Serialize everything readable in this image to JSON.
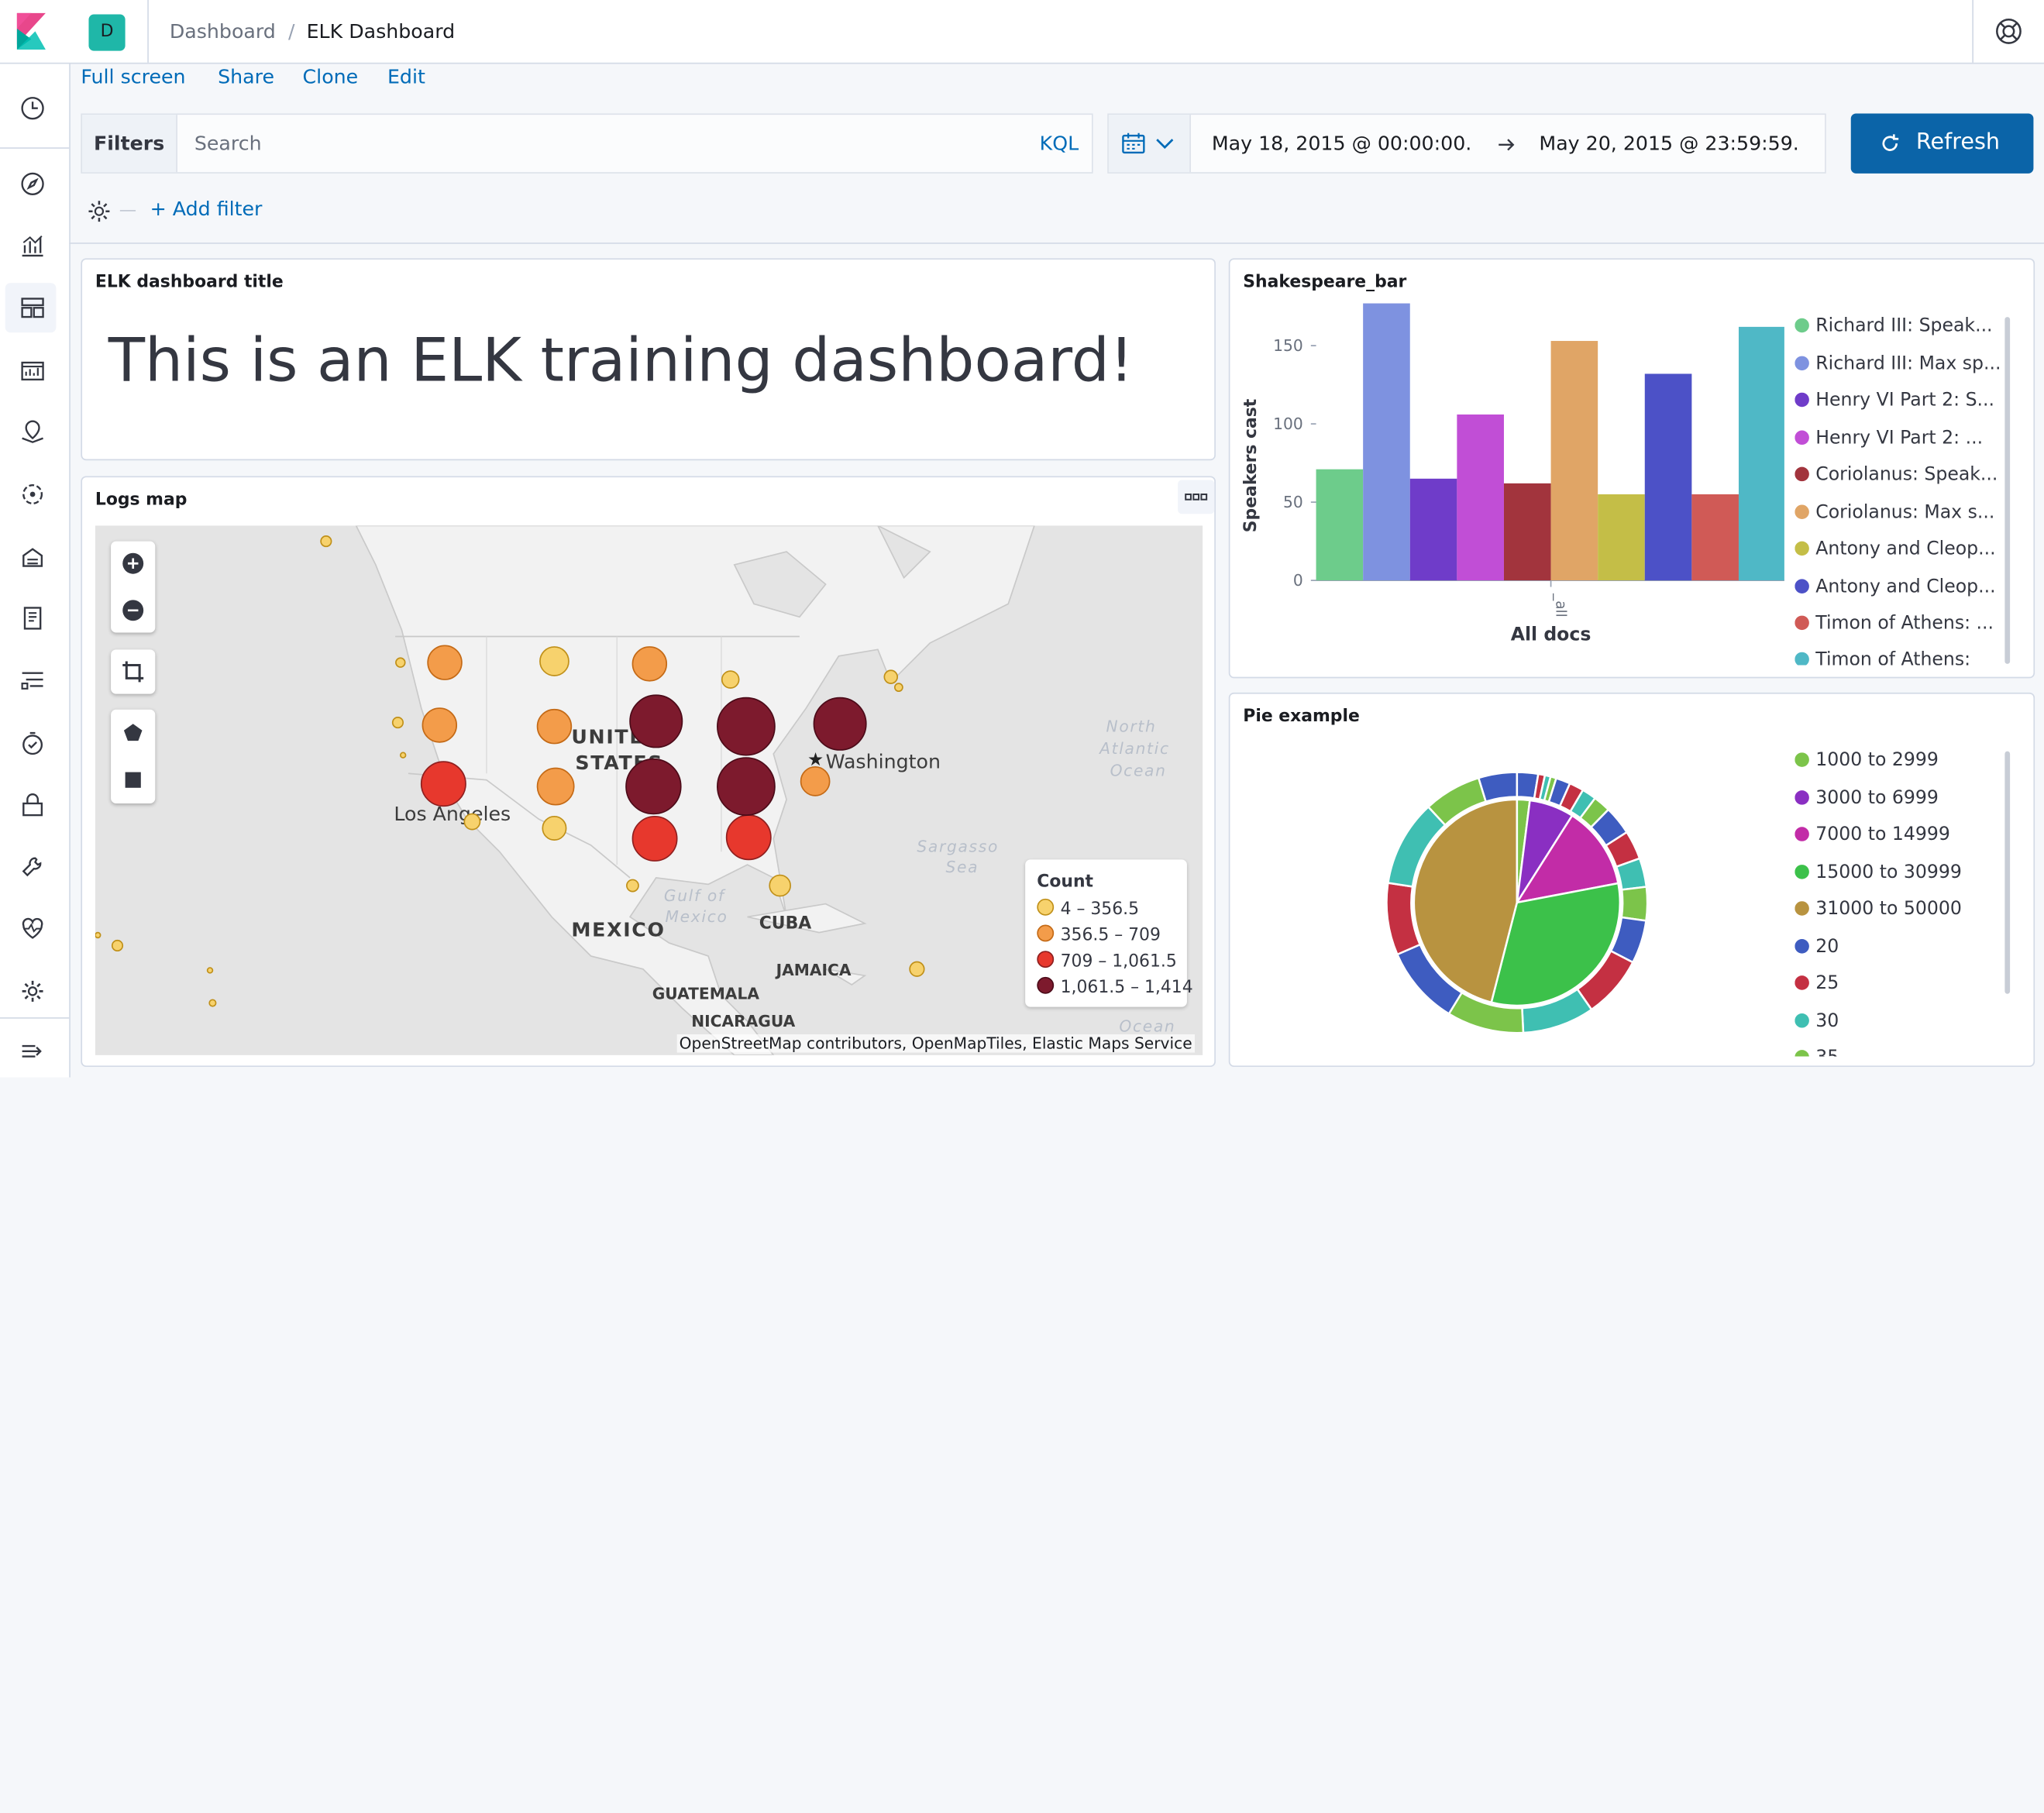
{
  "header": {
    "space_initial": "D",
    "breadcrumb_root": "Dashboard",
    "breadcrumb_current": "ELK Dashboard"
  },
  "top_links": [
    "Full screen",
    "Share",
    "Clone",
    "Edit"
  ],
  "query_bar": {
    "filters_label": "Filters",
    "search_placeholder": "Search",
    "language": "KQL",
    "date_start": "May 18, 2015 @ 00:00:00.",
    "date_end": "May 20, 2015 @ 23:59:59.",
    "refresh_label": "Refresh",
    "add_filter": "+ Add filter"
  },
  "panels": {
    "markdown": {
      "title": "ELK dashboard title",
      "text": "This is an ELK training dashboard!"
    },
    "map": {
      "title": "Logs map",
      "labels": [
        "UNITED",
        "STATES",
        "Washington",
        "Los Angeles",
        "MEXICO",
        "CUBA",
        "JAMAICA",
        "GUATEMALA",
        "NICARAGUA"
      ],
      "ocean_labels": [
        "North",
        "Atlantic",
        "Ocean",
        "Sargasso",
        "Sea",
        "Gulf of",
        "Mexico",
        "Ocean"
      ],
      "attribution": "OpenStreetMap contributors, OpenMapTiles, Elastic Maps Service",
      "legend_title": "Count",
      "legend": [
        {
          "label": "4 – 356.5",
          "color": "#f7d26d"
        },
        {
          "label": "356.5 – 709",
          "color": "#f39c4a"
        },
        {
          "label": "709 – 1,061.5",
          "color": "#e7382d"
        },
        {
          "label": "1,061.5 – 1,414",
          "color": "#7d1a2d"
        }
      ]
    },
    "bar": {
      "title": "Shakespeare_bar",
      "legend": [
        {
          "label": "Richard III: Speak...",
          "color": "#6dcc8b"
        },
        {
          "label": "Richard III: Max sp...",
          "color": "#7e92e0"
        },
        {
          "label": "Henry VI Part 2: S...",
          "color": "#6f3cc9"
        },
        {
          "label": "Henry VI Part 2: ...",
          "color": "#c14ed6"
        },
        {
          "label": "Coriolanus: Speak...",
          "color": "#a2343d"
        },
        {
          "label": "Coriolanus: Max s...",
          "color": "#e0a566"
        },
        {
          "label": "Antony and Cleop...",
          "color": "#c4be47"
        },
        {
          "label": "Antony and Cleop...",
          "color": "#4c51c7"
        },
        {
          "label": "Timon of Athens: ...",
          "color": "#d05a56"
        },
        {
          "label": "Timon of Athens:",
          "color": "#4fb8c6"
        }
      ]
    },
    "pie": {
      "title": "Pie example",
      "legend": [
        {
          "label": "1000 to 2999",
          "color": "#7cc44a"
        },
        {
          "label": "3000 to 6999",
          "color": "#8a2fc2"
        },
        {
          "label": "7000 to 14999",
          "color": "#c22ca7"
        },
        {
          "label": "15000 to 30999",
          "color": "#3cc14a"
        },
        {
          "label": "31000 to 50000",
          "color": "#b89340"
        },
        {
          "label": "20",
          "color": "#3e5cc0"
        },
        {
          "label": "25",
          "color": "#c43042"
        },
        {
          "label": "30",
          "color": "#3fbfb2"
        },
        {
          "label": "35",
          "color": "#7cc44a"
        }
      ]
    }
  },
  "chart_data": [
    {
      "type": "bar",
      "title": "Shakespeare_bar",
      "xlabel": "All docs",
      "ylabel": "Speakers cast",
      "categories": [
        "_all"
      ],
      "ylim": [
        0,
        180
      ],
      "yticks": [
        0,
        50,
        100,
        150
      ],
      "series": [
        {
          "name": "Richard III: Speak...",
          "values": [
            71
          ]
        },
        {
          "name": "Richard III: Max sp...",
          "values": [
            177
          ]
        },
        {
          "name": "Henry VI Part 2: S...",
          "values": [
            65
          ]
        },
        {
          "name": "Henry VI Part 2: ...",
          "values": [
            106
          ]
        },
        {
          "name": "Coriolanus: Speak...",
          "values": [
            62
          ]
        },
        {
          "name": "Coriolanus: Max s...",
          "values": [
            153
          ]
        },
        {
          "name": "Antony and Cleop...",
          "values": [
            55
          ]
        },
        {
          "name": "Antony and Cleop...",
          "values": [
            132
          ]
        },
        {
          "name": "Timon of Athens: ...",
          "values": [
            55
          ]
        },
        {
          "name": "Timon of Athens:",
          "values": [
            162
          ]
        }
      ]
    },
    {
      "type": "pie",
      "title": "Pie example",
      "inner": [
        {
          "label": "1000 to 2999",
          "value": 2
        },
        {
          "label": "3000 to 6999",
          "value": 7
        },
        {
          "label": "7000 to 14999",
          "value": 13
        },
        {
          "label": "15000 to 30999",
          "value": 32
        },
        {
          "label": "31000 to 50000",
          "value": 46
        }
      ],
      "outer": [
        {
          "label": "20",
          "value": 2.2
        },
        {
          "label": "25",
          "value": 0.7
        },
        {
          "label": "30",
          "value": 0.6
        },
        {
          "label": "35",
          "value": 0.6
        },
        {
          "label": "20",
          "value": 1.5
        },
        {
          "label": "25",
          "value": 1.5
        },
        {
          "label": "30",
          "value": 1.5
        },
        {
          "label": "35",
          "value": 1.8
        },
        {
          "label": "20",
          "value": 3.0
        },
        {
          "label": "25",
          "value": 3.0
        },
        {
          "label": "30",
          "value": 3.0
        },
        {
          "label": "35",
          "value": 3.5
        },
        {
          "label": "20",
          "value": 4.5
        },
        {
          "label": "25",
          "value": 6.5
        },
        {
          "label": "30",
          "value": 7.5
        },
        {
          "label": "35",
          "value": 8.0
        },
        {
          "label": "20",
          "value": 8.2
        },
        {
          "label": "25",
          "value": 7.5
        },
        {
          "label": "30",
          "value": 9.0
        },
        {
          "label": "35",
          "value": 6.0
        },
        {
          "label": "20",
          "value": 4.0
        }
      ]
    }
  ]
}
